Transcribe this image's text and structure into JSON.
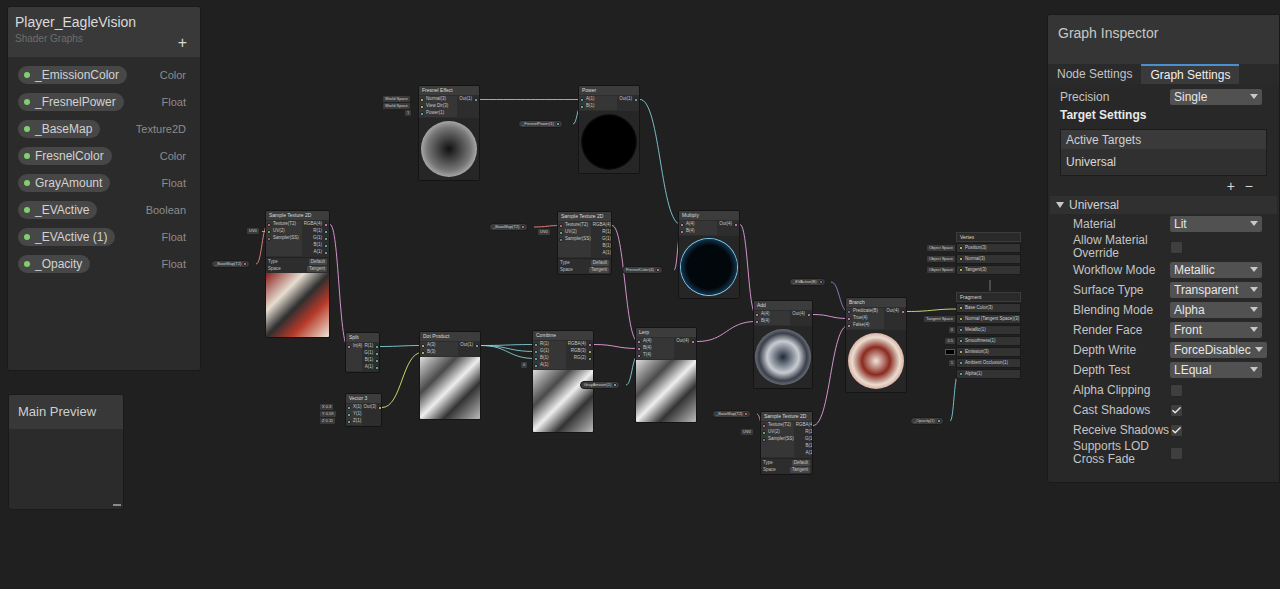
{
  "blackboard": {
    "title": "Player_EagleVision",
    "subtitle": "Shader Graphs",
    "add_button": "+",
    "properties": [
      {
        "name": "_EmissionColor",
        "type": "Color"
      },
      {
        "name": "_FresnelPower",
        "type": "Float"
      },
      {
        "name": "_BaseMap",
        "type": "Texture2D"
      },
      {
        "name": "FresnelColor",
        "type": "Color"
      },
      {
        "name": "GrayAmount",
        "type": "Float"
      },
      {
        "name": "_EVActive",
        "type": "Boolean"
      },
      {
        "name": "_EVActive (1)",
        "type": "Float"
      },
      {
        "name": "_Opacity",
        "type": "Float"
      }
    ]
  },
  "main_preview": {
    "title": "Main Preview"
  },
  "inspector": {
    "title": "Graph Inspector",
    "tabs": [
      {
        "label": "Node Settings",
        "selected": false
      },
      {
        "label": "Graph Settings",
        "selected": true
      }
    ],
    "precision": {
      "label": "Precision",
      "value": "Single"
    },
    "target_settings": {
      "title": "Target Settings",
      "list_header": "Active Targets",
      "targets": [
        "Universal"
      ],
      "add_button": "+",
      "remove_button": "−"
    },
    "section": {
      "title": "Universal",
      "expanded": true,
      "rows": [
        {
          "label": "Material",
          "kind": "dropdown",
          "value": "Lit"
        },
        {
          "label": "Allow Material Override",
          "kind": "checkbox",
          "checked": false
        },
        {
          "label": "Workflow Mode",
          "kind": "dropdown",
          "value": "Metallic"
        },
        {
          "label": "Surface Type",
          "kind": "dropdown",
          "value": "Transparent"
        },
        {
          "label": "Blending Mode",
          "kind": "dropdown",
          "value": "Alpha"
        },
        {
          "label": "Render Face",
          "kind": "dropdown",
          "value": "Front"
        },
        {
          "label": "Depth Write",
          "kind": "dropdown",
          "value": "ForceDisablec"
        },
        {
          "label": "Depth Test",
          "kind": "dropdown",
          "value": "LEqual"
        },
        {
          "label": "Alpha Clipping",
          "kind": "checkbox",
          "checked": false
        },
        {
          "label": "Cast Shadows",
          "kind": "checkbox",
          "checked": true
        },
        {
          "label": "Receive Shadows",
          "kind": "checkbox",
          "checked": true
        },
        {
          "label": "Supports LOD Cross Fade",
          "kind": "checkbox",
          "checked": false
        }
      ]
    }
  },
  "graph": {
    "nodes": [
      {
        "title": "Fresnel Effect",
        "inputs": [
          "Normal(3)",
          "View Dir(3)",
          "Power(1)"
        ],
        "outputs": [
          "Out(1)"
        ],
        "fields": [],
        "preview": "fresnel"
      },
      {
        "title": "Power",
        "inputs": [
          "A(1)",
          "B(1)"
        ],
        "outputs": [
          "Out(1)"
        ],
        "fields": [],
        "preview": "power"
      },
      {
        "title": "Sample Texture 2D",
        "inputs": [
          "Texture(T2)",
          "UV(2)",
          "Sampler(SS)"
        ],
        "outputs": [
          "RGBA(4)",
          "R(1)",
          "G(1)",
          "B(1)",
          "A(1)"
        ],
        "fields": [
          {
            "label": "Type",
            "value": "Default"
          },
          {
            "label": "Space",
            "value": "Tangent"
          }
        ],
        "preview": "texture"
      },
      {
        "title": "Sample Texture 2D",
        "inputs": [
          "Texture(T2)",
          "UV(2)",
          "Sampler(SS)"
        ],
        "outputs": [
          "RGBA(4)",
          "R(1)",
          "G(1)",
          "B(1)",
          "A(1)"
        ],
        "fields": [
          {
            "label": "Type",
            "value": "Default"
          },
          {
            "label": "Space",
            "value": "Tangent"
          }
        ],
        "preview": "none"
      },
      {
        "title": "Multiply",
        "inputs": [
          "A(4)",
          "B(4)"
        ],
        "outputs": [
          "Out(4)"
        ],
        "fields": [],
        "preview": "glow"
      },
      {
        "title": "Split",
        "inputs": [
          "In(4)"
        ],
        "outputs": [
          "R(1)",
          "G(1)",
          "B(1)",
          "A(1)"
        ],
        "fields": [],
        "preview": "none"
      },
      {
        "title": "Vector 3",
        "inputs": [
          "X(1)",
          "Y(1)",
          "Z(1)"
        ],
        "outputs": [
          "Out(3)"
        ],
        "fields": [],
        "preview": "none"
      },
      {
        "title": "Dot Product",
        "inputs": [
          "A(3)",
          "B(3)"
        ],
        "outputs": [
          "Out(1)"
        ],
        "fields": [],
        "preview": "gray"
      },
      {
        "title": "Combine",
        "inputs": [
          "R(1)",
          "G(1)",
          "B(1)",
          "A(1)"
        ],
        "outputs": [
          "RGBA(4)",
          "RGB(3)",
          "RG(2)"
        ],
        "fields": [],
        "preview": "gray"
      },
      {
        "title": "Lerp",
        "inputs": [
          "A(4)",
          "B(4)",
          "T(4)"
        ],
        "outputs": [
          "Out(4)"
        ],
        "fields": [],
        "preview": "gray"
      },
      {
        "title": "Add",
        "inputs": [
          "A(4)",
          "B(4)"
        ],
        "outputs": [
          "Out(4)"
        ],
        "fields": [],
        "preview": "sphere"
      },
      {
        "title": "Sample Texture 2D",
        "inputs": [
          "Texture(T2)",
          "UV(2)",
          "Sampler(SS)"
        ],
        "outputs": [
          "RGBA(4)",
          "R(1)",
          "G(1)",
          "B(1)",
          "A(1)"
        ],
        "fields": [
          {
            "label": "Type",
            "value": "Default"
          },
          {
            "label": "Space",
            "value": "Tangent"
          }
        ],
        "preview": "none"
      },
      {
        "title": "Branch",
        "inputs": [
          "Predicate(B)",
          "True(4)",
          "False(4)"
        ],
        "outputs": [
          "Out(4)"
        ],
        "fields": [],
        "preview": "sphere2"
      }
    ],
    "property_nodes": [
      {
        "label": "_BaseMap(T2)"
      },
      {
        "label": "_BaseMap(T2)"
      },
      {
        "label": "_FresnelPower(1)"
      },
      {
        "label": "FresnelColor(4)"
      },
      {
        "label": "GrayAmount(1)"
      },
      {
        "label": "_EVActive(B)"
      },
      {
        "label": "_BaseMap(T2)"
      },
      {
        "label": "_Opacity(1)"
      }
    ],
    "inline_values": [
      {
        "label": "World Space"
      },
      {
        "label": "World Space"
      },
      {
        "label": "1"
      },
      {
        "label": "UV0"
      },
      {
        "label": "UV0"
      },
      {
        "label": "X 0.3"
      },
      {
        "label": "Y 0.59"
      },
      {
        "label": "Z 0.11"
      },
      {
        "label": "0"
      },
      {
        "label": "UV0"
      }
    ],
    "vertex": {
      "title": "Vertex",
      "blocks": [
        {
          "label": "Position(3)",
          "value": "Object Space"
        },
        {
          "label": "Normal(3)",
          "value": "Object Space"
        },
        {
          "label": "Tangent(3)",
          "value": "Object Space"
        }
      ]
    },
    "fragment": {
      "title": "Fragment",
      "blocks": [
        {
          "label": "Base Color(3)"
        },
        {
          "label": "Normal (Tangent Space)(3)",
          "value": "Tangent Space"
        },
        {
          "label": "Metallic(1)",
          "value": "0"
        },
        {
          "label": "Smoothness(1)",
          "value": "0.5"
        },
        {
          "label": "Emission(3)",
          "swatch": "#000000"
        },
        {
          "label": "Ambient Occlusion(1)",
          "value": "1"
        },
        {
          "label": "Alpha(1)"
        }
      ]
    }
  }
}
